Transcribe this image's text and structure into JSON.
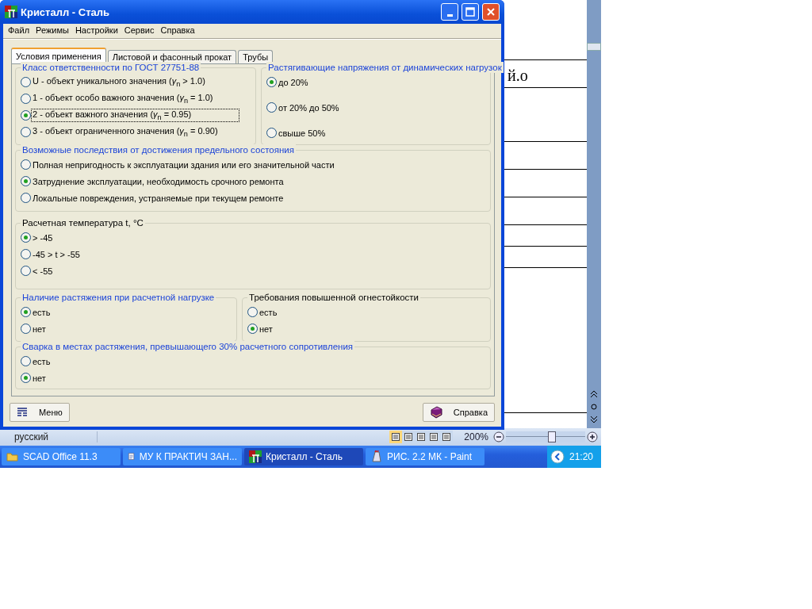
{
  "window": {
    "title": "Кристалл - Сталь"
  },
  "menu": [
    "Файл",
    "Режимы",
    "Настройки",
    "Сервис",
    "Справка"
  ],
  "tabs": [
    {
      "label": "Условия применения",
      "selected": true
    },
    {
      "label": "Листовой и фасонный прокат",
      "selected": false
    },
    {
      "label": "Трубы",
      "selected": false
    }
  ],
  "rows": [
    {
      "groups": [
        {
          "title": "Класс ответственности по ГОСТ 27751-88",
          "color": "#1c44d8",
          "options": [
            {
              "label": "U - объект уникального значения (*γ*$_{n}$ > 1.0)",
              "selected": false,
              "focused": false
            },
            {
              "label": "1 - объект особо важного значения (*γ*$_{n}$ = 1.0)",
              "selected": false,
              "focused": false
            },
            {
              "label": "2 - объект важного значения (*γ*$_{n}$ = 0.95)",
              "selected": true,
              "focused": true
            },
            {
              "label": "3 - объект ограниченного значения (*γ*$_{n}$ = 0.90)",
              "selected": false,
              "focused": false
            }
          ]
        },
        {
          "title": "Растягивающие напряжения от динамических нагрузок",
          "color": "#1c44d8",
          "options": [
            {
              "label": "до 20%",
              "selected": true
            },
            {
              "label": "от 20% до 50%",
              "selected": false
            },
            {
              "label": "свыше 50%",
              "selected": false
            }
          ]
        }
      ]
    },
    {
      "groups": [
        {
          "title": "Возможные последствия от достижения предельного состояния",
          "color": "#1c44d8",
          "options": [
            {
              "label": "Полная непригодность к эксплуатации здания или его значительной части",
              "selected": false
            },
            {
              "label": "Затруднение эксплуатации, необходимость срочного ремонта",
              "selected": true
            },
            {
              "label": "Локальные повреждения, устраняемые при текущем ремонте",
              "selected": false
            }
          ]
        }
      ]
    },
    {
      "groups": [
        {
          "title": "Расчетная температура t, °С",
          "color": "#000000",
          "options": [
            {
              "label": "> -45",
              "selected": true
            },
            {
              "label": "-45 > t > -55",
              "selected": false
            },
            {
              "label": "< -55",
              "selected": false
            }
          ]
        }
      ]
    },
    {
      "groups": [
        {
          "title": "Наличие растяжения при расчетной нагрузке",
          "color": "#1c44d8",
          "options": [
            {
              "label": "есть",
              "selected": true
            },
            {
              "label": "нет",
              "selected": false
            }
          ]
        },
        {
          "title": "Требования повышенной огнестойкости",
          "color": "#000000",
          "options": [
            {
              "label": "есть",
              "selected": false
            },
            {
              "label": "нет",
              "selected": true
            }
          ]
        }
      ]
    },
    {
      "groups": [
        {
          "title": "Сварка в местах растяжения, превышающего 30% расчетного сопротивления",
          "color": "#1c44d8",
          "options": [
            {
              "label": "есть",
              "selected": false
            },
            {
              "label": "нет",
              "selected": true
            }
          ]
        }
      ]
    }
  ],
  "buttons": [
    {
      "kind": "menu",
      "label": "Меню"
    },
    {
      "kind": "help",
      "label": "Справка"
    }
  ],
  "background_document": {
    "text": "й.о",
    "language": "русский",
    "zoom": "200%",
    "zoom_slider": {
      "level": 0.57
    }
  },
  "taskbar": {
    "items": [
      {
        "kind": "folder",
        "label": "SCAD Office 11.3",
        "selected": false
      },
      {
        "kind": "word",
        "label": "МУ К ПРАКТИЧ ЗАН...",
        "selected": false
      },
      {
        "kind": "app",
        "label": "Кристалл - Сталь",
        "selected": true
      },
      {
        "kind": "paint",
        "label": "РИС. 2.2 МК - Paint",
        "selected": false
      }
    ],
    "clock": "21:20"
  }
}
